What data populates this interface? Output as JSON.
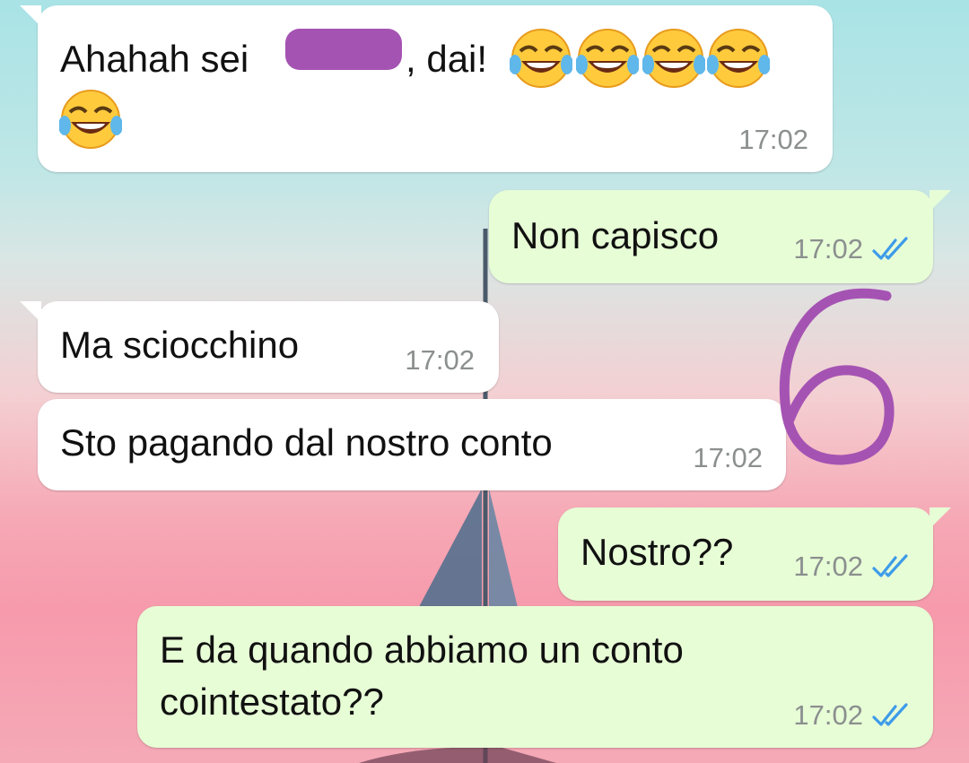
{
  "messages": [
    {
      "direction": "incoming",
      "text_before": "Ahahah sei ",
      "text_after": ", dai!",
      "emoji_icons": [
        "face-with-tears-of-joy-icon",
        "face-with-tears-of-joy-icon",
        "face-with-tears-of-joy-icon",
        "face-with-tears-of-joy-icon",
        "face-with-tears-of-joy-icon"
      ],
      "time": "17:02"
    },
    {
      "direction": "outgoing",
      "text": "Non capisco",
      "time": "17:02",
      "status_icon": "double-check-read-icon"
    },
    {
      "direction": "incoming",
      "text": "Ma sciocchino",
      "time": "17:02"
    },
    {
      "direction": "incoming",
      "text": "Sto pagando dal nostro conto",
      "time": "17:02"
    },
    {
      "direction": "outgoing",
      "text": "Nostro??",
      "time": "17:02",
      "status_icon": "double-check-read-icon"
    },
    {
      "direction": "outgoing",
      "text_line1": "E da quando abbiamo un conto",
      "text_line2": "cointestato??",
      "time": "17:02",
      "status_icon": "double-check-read-icon"
    }
  ],
  "annotation": {
    "text": "6",
    "color": "#a553b3"
  },
  "colors": {
    "incoming_bubble": "#ffffff",
    "outgoing_bubble": "#e7fdd6",
    "read_ticks": "#3d9be9",
    "timestamp": "#8b8f8e",
    "redaction": "#a553b3"
  }
}
